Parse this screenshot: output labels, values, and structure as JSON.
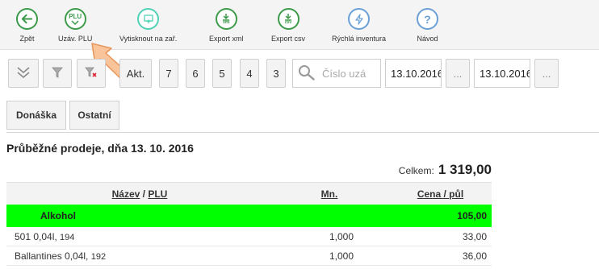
{
  "toolbar": {
    "items": [
      {
        "label": "Zpět",
        "icon": "arrow-left-icon"
      },
      {
        "label": "Uzáv. PLU",
        "icon": "plu-check-icon",
        "badge": "PLU"
      },
      {
        "label": "Vytisknout na zař.",
        "icon": "print-to-device-icon"
      },
      {
        "label": "Export xml",
        "icon": "export-xml-icon",
        "badge": "xml"
      },
      {
        "label": "Export csv",
        "icon": "export-csv-icon",
        "badge": "csv"
      },
      {
        "label": "Rýchlá inventura",
        "icon": "lightning-icon"
      },
      {
        "label": "Návod",
        "icon": "help-icon"
      }
    ]
  },
  "filters": {
    "akt_label": "Akt.",
    "numbers": [
      "7",
      "6",
      "5",
      "4",
      "3"
    ],
    "search_placeholder": "Číslo uzá",
    "date_from": "13.10.2016",
    "date_to": "13.10.2016",
    "ellipsis": "..."
  },
  "tabs": [
    "Donáška",
    "Ostatní"
  ],
  "title": "Průběžné prodeje, dňa 13. 10. 2016",
  "total": {
    "label": "Celkem:",
    "value": "1 319,00"
  },
  "table": {
    "headers": {
      "name": "Název",
      "slash": " / ",
      "plu": "PLU",
      "qty": "Mn.",
      "price": "Cena / půl"
    },
    "group": {
      "name": "Alkohol",
      "price": "105,00"
    },
    "rows": [
      {
        "name": "501 0,04l, ",
        "plu": "194",
        "qty": "1,000",
        "price": "33,00"
      },
      {
        "name": "Ballantines 0,04l, ",
        "plu": "192",
        "qty": "1,000",
        "price": "36,00"
      }
    ]
  },
  "colors": {
    "accent_green": "#3c9a4a",
    "group_bg": "#00ff00",
    "arrow": "#f7b27a"
  }
}
